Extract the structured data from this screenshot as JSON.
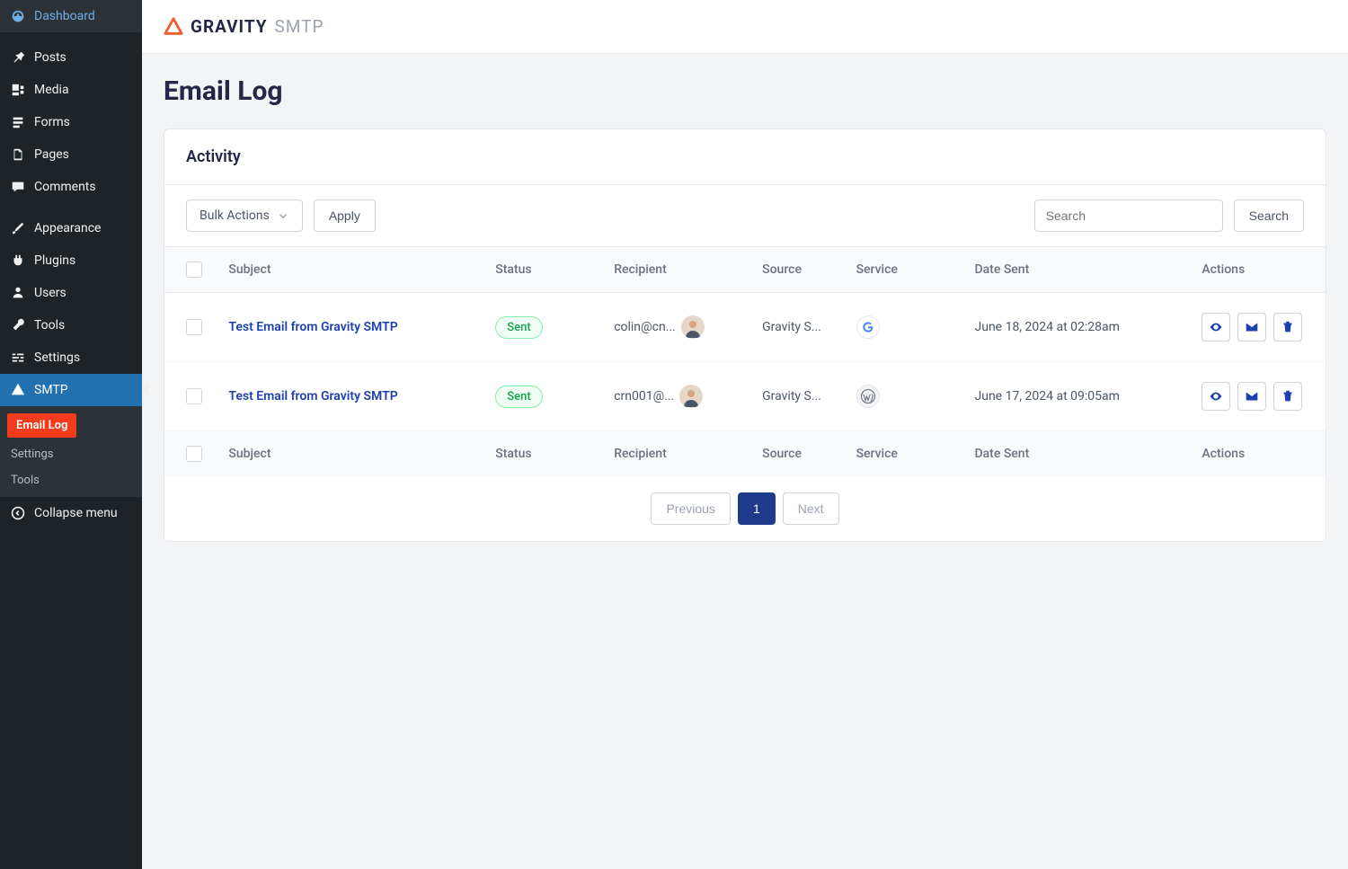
{
  "sidebar": {
    "items": [
      {
        "label": "Dashboard"
      },
      {
        "label": "Posts"
      },
      {
        "label": "Media"
      },
      {
        "label": "Forms"
      },
      {
        "label": "Pages"
      },
      {
        "label": "Comments"
      },
      {
        "label": "Appearance"
      },
      {
        "label": "Plugins"
      },
      {
        "label": "Users"
      },
      {
        "label": "Tools"
      },
      {
        "label": "Settings"
      },
      {
        "label": "SMTP"
      }
    ],
    "submenu": [
      {
        "label": "Email Log"
      },
      {
        "label": "Settings"
      },
      {
        "label": "Tools"
      }
    ],
    "collapse_label": "Collapse menu"
  },
  "header": {
    "logo_main": "GRAVITY",
    "logo_sub": "SMTP"
  },
  "page": {
    "title": "Email Log",
    "card_title": "Activity"
  },
  "toolbar": {
    "bulk_label": "Bulk Actions",
    "apply_label": "Apply",
    "search_placeholder": "Search",
    "search_button": "Search"
  },
  "table": {
    "columns": {
      "subject": "Subject",
      "status": "Status",
      "recipient": "Recipient",
      "source": "Source",
      "service": "Service",
      "date": "Date Sent",
      "actions": "Actions"
    },
    "rows": [
      {
        "subject": "Test Email from Gravity SMTP",
        "status": "Sent",
        "recipient": "colin@cn...",
        "source": "Gravity S...",
        "service": "google",
        "date": "June 18, 2024 at 02:28am"
      },
      {
        "subject": "Test Email from Gravity SMTP",
        "status": "Sent",
        "recipient": "crn001@...",
        "source": "Gravity S...",
        "service": "wordpress",
        "date": "June 17, 2024 at 09:05am"
      }
    ]
  },
  "pagination": {
    "previous": "Previous",
    "current": "1",
    "next": "Next"
  }
}
